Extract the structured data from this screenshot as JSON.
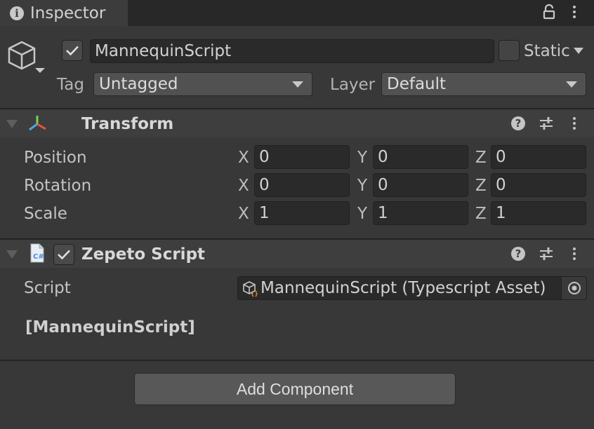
{
  "tab": {
    "title": "Inspector",
    "info_icon_glyph": "i"
  },
  "object": {
    "active_checked": true,
    "name": "MannequinScript",
    "static_label": "Static",
    "static_checked": false,
    "tag_label": "Tag",
    "tag_value": "Untagged",
    "layer_label": "Layer",
    "layer_value": "Default"
  },
  "transform": {
    "title": "Transform",
    "rows": [
      {
        "label": "Position",
        "x": "0",
        "y": "0",
        "z": "0"
      },
      {
        "label": "Rotation",
        "x": "0",
        "y": "0",
        "z": "0"
      },
      {
        "label": "Scale",
        "x": "1",
        "y": "1",
        "z": "1"
      }
    ],
    "axis_x": "X",
    "axis_y": "Y",
    "axis_z": "Z"
  },
  "zepeto": {
    "title": "Zepeto Script",
    "enabled": true,
    "script_label": "Script",
    "script_value": "MannequinScript (Typescript Asset)",
    "class_name": "[MannequinScript]"
  },
  "help_glyph": "?",
  "add_component_label": "Add Component",
  "icons": {
    "info": "info-icon",
    "lock": "lock-icon",
    "menu": "kebab-menu-icon",
    "gameobject": "cube-icon",
    "transform": "transform-axes-icon",
    "script": "csharp-script-icon",
    "asset": "typescript-asset-icon",
    "picker": "object-picker-icon"
  },
  "colors": {
    "background": "#383838",
    "tabbar": "#282828",
    "field": "#2a2a2a",
    "button": "#585858"
  }
}
